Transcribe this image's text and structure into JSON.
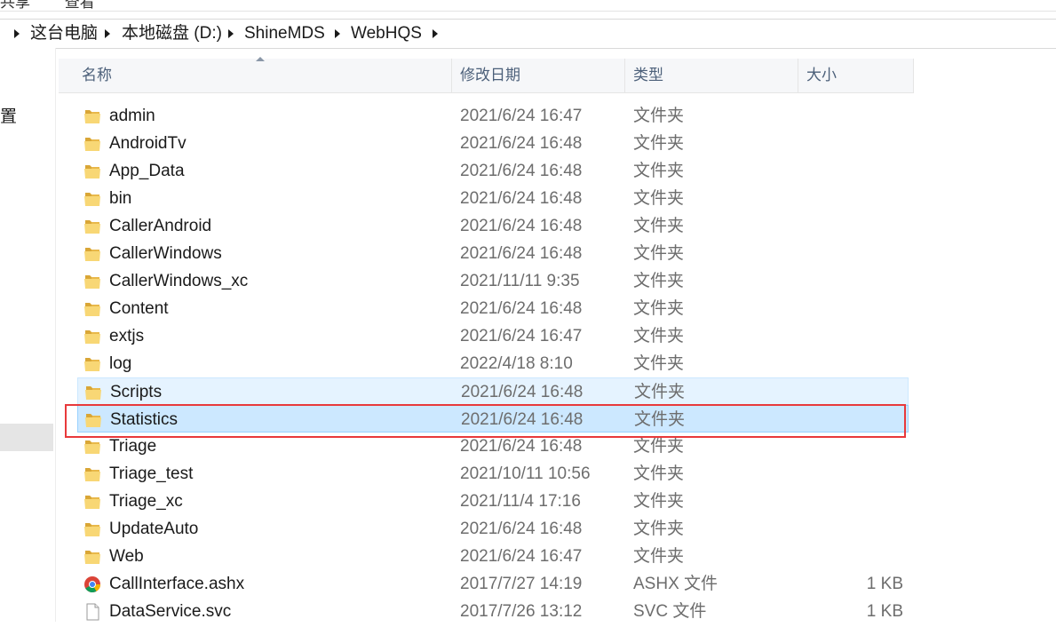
{
  "menu": [
    "共享",
    "查看"
  ],
  "breadcrumb": [
    "这台电脑",
    "本地磁盘 (D:)",
    "ShineMDS",
    "WebHQS"
  ],
  "nav": {
    "partial_label": "置"
  },
  "columns": {
    "name": "名称",
    "date": "修改日期",
    "type": "类型",
    "size": "大小"
  },
  "files": [
    {
      "name": "admin",
      "date": "2021/6/24 16:47",
      "type": "文件夹",
      "size": "",
      "icon": "folder-icon"
    },
    {
      "name": "AndroidTv",
      "date": "2021/6/24 16:48",
      "type": "文件夹",
      "size": "",
      "icon": "folder-icon"
    },
    {
      "name": "App_Data",
      "date": "2021/6/24 16:48",
      "type": "文件夹",
      "size": "",
      "icon": "folder-icon"
    },
    {
      "name": "bin",
      "date": "2021/6/24 16:48",
      "type": "文件夹",
      "size": "",
      "icon": "folder-icon"
    },
    {
      "name": "CallerAndroid",
      "date": "2021/6/24 16:48",
      "type": "文件夹",
      "size": "",
      "icon": "folder-icon"
    },
    {
      "name": "CallerWindows",
      "date": "2021/6/24 16:48",
      "type": "文件夹",
      "size": "",
      "icon": "folder-icon"
    },
    {
      "name": "CallerWindows_xc",
      "date": "2021/11/11 9:35",
      "type": "文件夹",
      "size": "",
      "icon": "folder-icon"
    },
    {
      "name": "Content",
      "date": "2021/6/24 16:48",
      "type": "文件夹",
      "size": "",
      "icon": "folder-icon"
    },
    {
      "name": "extjs",
      "date": "2021/6/24 16:47",
      "type": "文件夹",
      "size": "",
      "icon": "folder-icon"
    },
    {
      "name": "log",
      "date": "2022/4/18 8:10",
      "type": "文件夹",
      "size": "",
      "icon": "folder-icon"
    },
    {
      "name": "Scripts",
      "date": "2021/6/24 16:48",
      "type": "文件夹",
      "size": "",
      "icon": "folder-icon",
      "state": "hover"
    },
    {
      "name": "Statistics",
      "date": "2021/6/24 16:48",
      "type": "文件夹",
      "size": "",
      "icon": "folder-icon",
      "state": "selected"
    },
    {
      "name": "Triage",
      "date": "2021/6/24 16:48",
      "type": "文件夹",
      "size": "",
      "icon": "folder-icon"
    },
    {
      "name": "Triage_test",
      "date": "2021/10/11 10:56",
      "type": "文件夹",
      "size": "",
      "icon": "folder-icon"
    },
    {
      "name": "Triage_xc",
      "date": "2021/11/4 17:16",
      "type": "文件夹",
      "size": "",
      "icon": "folder-icon"
    },
    {
      "name": "UpdateAuto",
      "date": "2021/6/24 16:48",
      "type": "文件夹",
      "size": "",
      "icon": "folder-icon"
    },
    {
      "name": "Web",
      "date": "2021/6/24 16:47",
      "type": "文件夹",
      "size": "",
      "icon": "folder-icon"
    },
    {
      "name": "CallInterface.ashx",
      "date": "2017/7/27 14:19",
      "type": "ASHX 文件",
      "size": "1 KB",
      "icon": "chrome-icon"
    },
    {
      "name": "DataService.svc",
      "date": "2017/7/26 13:12",
      "type": "SVC 文件",
      "size": "1 KB",
      "icon": "file-icon"
    }
  ],
  "colors": {
    "selected_bg": "#cce8ff",
    "hover_bg": "#e5f3ff",
    "annotation": "#e8393b"
  }
}
